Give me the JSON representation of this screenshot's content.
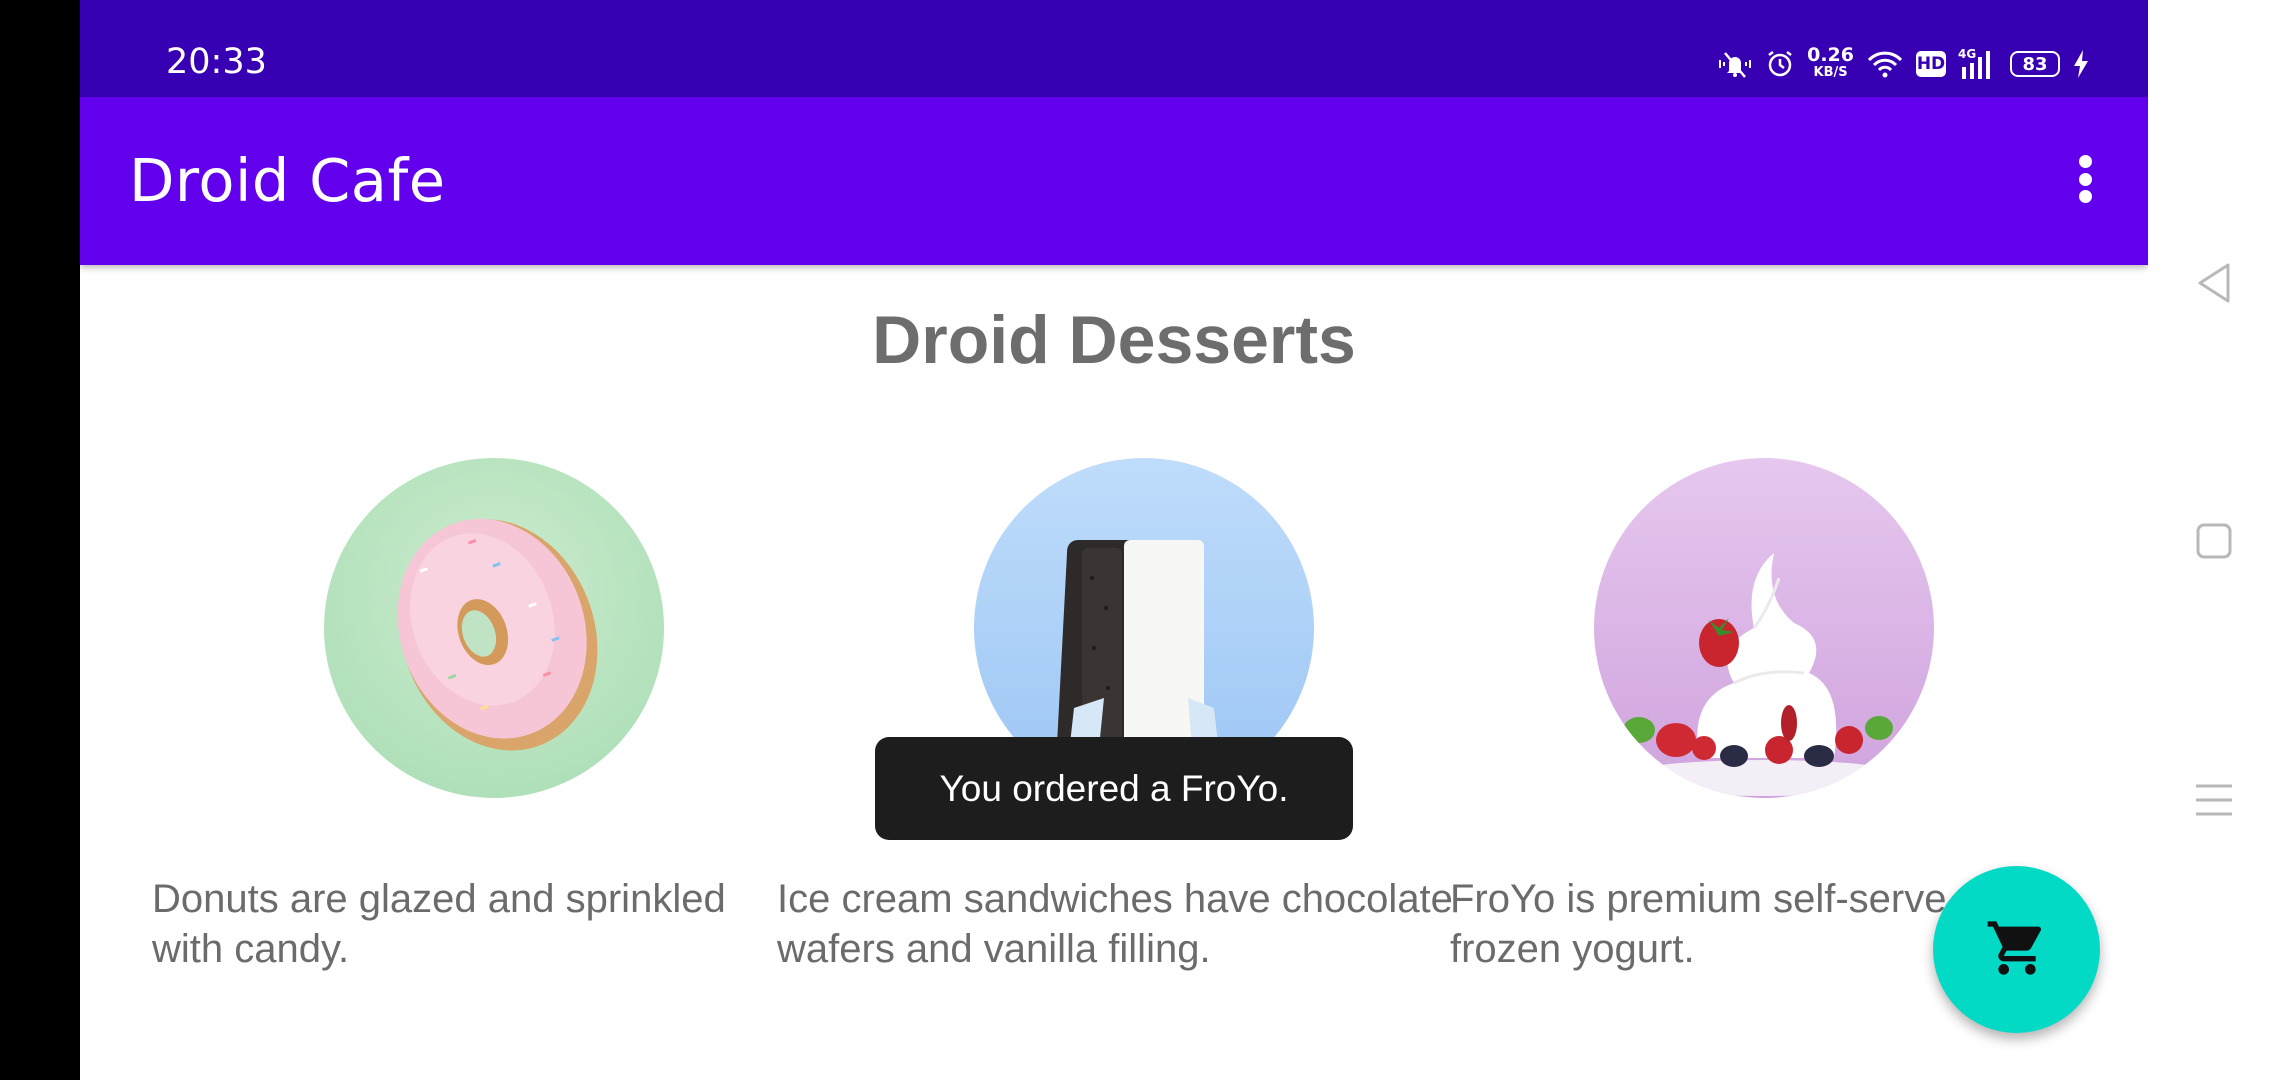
{
  "status_bar": {
    "time": "20:33",
    "net_speed_value": "0.26",
    "net_speed_unit": "KB/S",
    "hd": "HD",
    "network_type": "4G",
    "battery_level": "83",
    "icons": [
      "vibrate-mute-icon",
      "alarm-icon",
      "wifi-icon",
      "hd-icon",
      "signal-icon",
      "battery-icon",
      "charging-icon"
    ]
  },
  "app_bar": {
    "title": "Droid Cafe",
    "menu_icon": "overflow-menu-icon"
  },
  "main": {
    "title": "Droid Desserts",
    "desserts": [
      {
        "name": "donut",
        "description": "Donuts are glazed and sprinkled with candy."
      },
      {
        "name": "ice-cream-sandwich",
        "description": "Ice cream sandwiches have chocolate wafers and vanilla filling."
      },
      {
        "name": "froyo",
        "description": "FroYo is premium self-serve frozen yogurt."
      }
    ]
  },
  "toast": {
    "message": "You ordered a FroYo."
  },
  "fab": {
    "icon": "shopping-cart-icon"
  },
  "system_nav": {
    "buttons": [
      "back",
      "home",
      "recents"
    ]
  },
  "colors": {
    "status_bar": "#3700B3",
    "app_bar": "#6200EE",
    "fab": "#03DAC5",
    "toast": "#1D1D1D"
  }
}
